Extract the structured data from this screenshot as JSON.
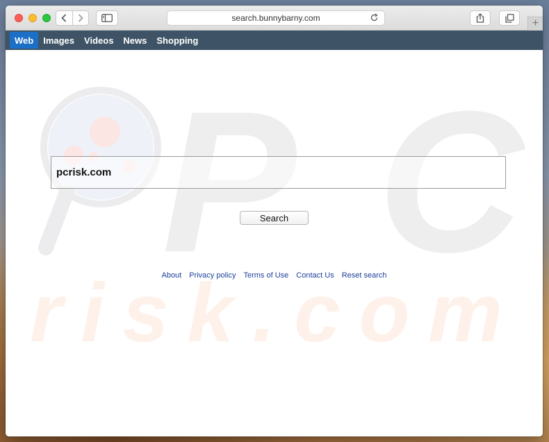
{
  "browser": {
    "url": "search.bunnybarny.com"
  },
  "search_nav": {
    "items": [
      {
        "label": "Web",
        "active": true
      },
      {
        "label": "Images",
        "active": false
      },
      {
        "label": "Videos",
        "active": false
      },
      {
        "label": "News",
        "active": false
      },
      {
        "label": "Shopping",
        "active": false
      }
    ]
  },
  "search": {
    "query": "pcrisk.com",
    "button_label": "Search"
  },
  "footer": {
    "links": [
      "About",
      "Privacy policy",
      "Terms of Use",
      "Contact Us",
      "Reset search"
    ]
  },
  "watermark": {
    "line1": "PC",
    "line2": "risk.com"
  },
  "colors": {
    "nav_bar": "#3e5466",
    "nav_active": "#1c6fc6",
    "link": "#1d3f9a"
  },
  "icons": [
    "back-arrow-icon",
    "forward-arrow-icon",
    "sidebar-icon",
    "reload-icon",
    "share-icon",
    "tabs-icon",
    "plus-icon",
    "magnifier-watermark-icon"
  ]
}
